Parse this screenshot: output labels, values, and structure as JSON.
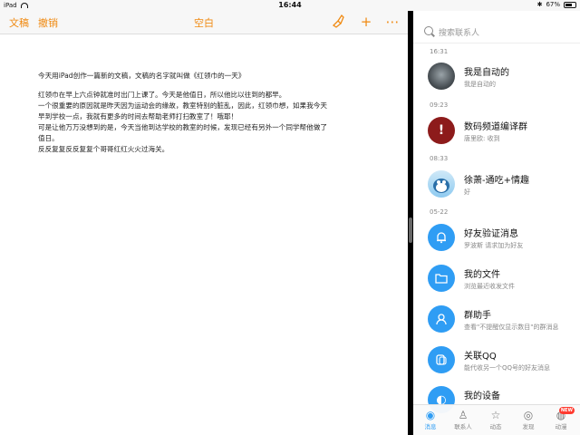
{
  "status_bar": {
    "device": "iPad",
    "time": "16:44",
    "battery": "67%",
    "bluetooth_icon": "bluetooth-icon"
  },
  "pages": {
    "toolbar": {
      "documents_label": "文稿",
      "undo_label": "撤销",
      "title": "空白"
    },
    "document": {
      "paragraphs": [
        "今天用iPad创作一篇新的文稿，文稿的名字就叫做《红领巾的一天》",
        "红领巾在早上六点钟就准时出门上课了。今天是他值日，所以他比以往到的都早。",
        "一个很重要的原因就是昨天因为运动会的缘故，教室特别的脏乱，因此，红领巾想，如果我今天早到学校一点，我就有更多的时间去帮助老师打扫教室了！哦耶！",
        "可是让他万万没想到的是，今天当他到达学校的教室的时候，发现已经有另外一个同学帮他做了值日。",
        "反反复复反反复复个哥哥红红火火过海关。"
      ]
    }
  },
  "qq": {
    "search_placeholder": "搜索联系人",
    "sections": [
      {
        "time": "16:31"
      },
      {
        "time": "09:23"
      },
      {
        "time": "08:33"
      },
      {
        "time": "05-22"
      }
    ],
    "chats": [
      {
        "name": "我是自动的",
        "preview": "我是自动的",
        "avatar": "person-photo"
      },
      {
        "name": "数码频道编译群",
        "preview": "唐里欧: 收到",
        "avatar": "exclamation-icon"
      },
      {
        "name": "徐萧-通吃+情趣",
        "preview": "好",
        "avatar": "penguin-avatar"
      },
      {
        "name": "好友验证消息",
        "preview": "罗波斯 请求加为好友",
        "avatar": "bell-icon"
      },
      {
        "name": "我的文件",
        "preview": "浏览最近收发文件",
        "avatar": "folder-icon"
      },
      {
        "name": "群助手",
        "preview": "查看\"不提醒仅显示数目\"的群消息",
        "avatar": "group-assistant-icon"
      },
      {
        "name": "关联QQ",
        "preview": "能代收另一个QQ号的好友消息",
        "avatar": "link-account-icon"
      },
      {
        "name": "我的设备",
        "preview": "",
        "avatar": "device-icon"
      }
    ],
    "tabs": [
      {
        "label": "消息",
        "icon": "message-icon"
      },
      {
        "label": "联系人",
        "icon": "contacts-icon"
      },
      {
        "label": "动态",
        "icon": "star-icon"
      },
      {
        "label": "发现",
        "icon": "discover-icon"
      },
      {
        "label": "动漫",
        "icon": "anime-icon"
      }
    ],
    "new_badge": "NEW"
  }
}
